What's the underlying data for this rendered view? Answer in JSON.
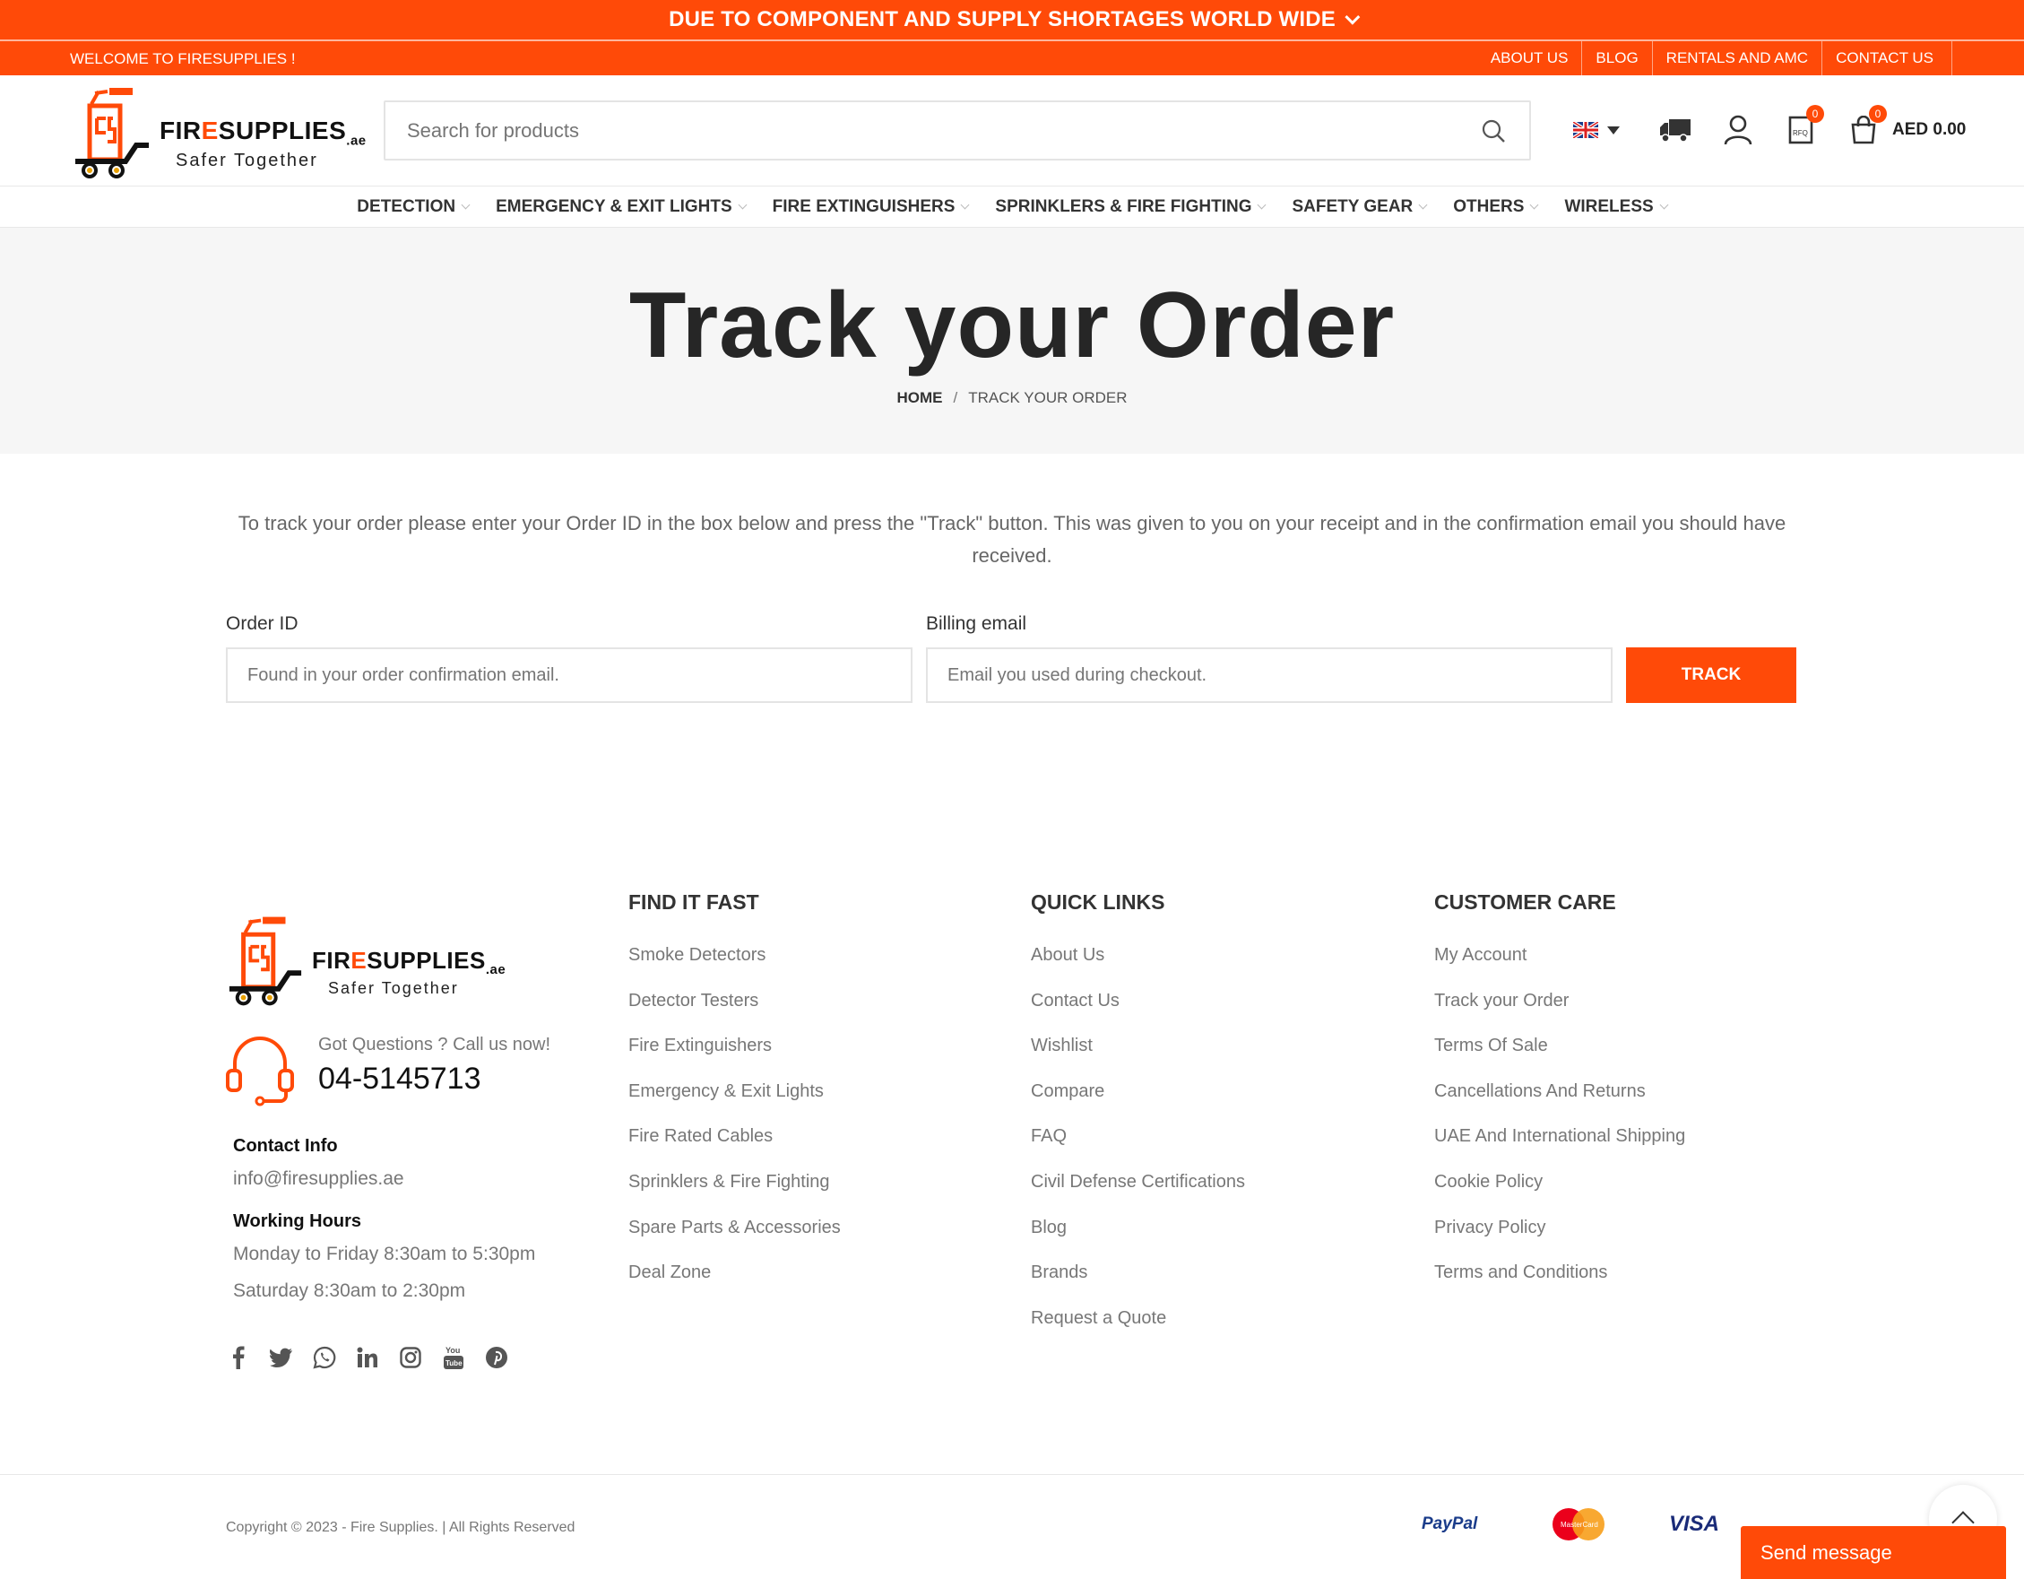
{
  "promo": {
    "text": "DUE TO COMPONENT AND SUPPLY SHORTAGES WORLD WIDE"
  },
  "topbar": {
    "welcome": "WELCOME TO FIRESUPPLIES !",
    "links": [
      "ABOUT US",
      "BLOG",
      "RENTALS AND AMC",
      "CONTACT US"
    ]
  },
  "header": {
    "logo": {
      "brand_prefix": "FIR",
      "brand_e": "E",
      "brand_suffix": "SUPPLIES",
      "brand_tld": ".ae",
      "tagline": "Safer Together"
    },
    "search": {
      "placeholder": "Search for products"
    },
    "cart_total": "AED 0.00",
    "badges": {
      "rfq": "0",
      "cart": "0"
    },
    "icons": [
      "flag-uk-icon",
      "truck-icon",
      "user-icon",
      "rfq-icon",
      "cart-icon",
      "search-icon"
    ]
  },
  "nav": {
    "items": [
      "DETECTION",
      "EMERGENCY & EXIT LIGHTS",
      "FIRE EXTINGUISHERS",
      "SPRINKLERS & FIRE FIGHTING",
      "SAFETY GEAR",
      "OTHERS",
      "WIRELESS"
    ]
  },
  "title": {
    "heading": "Track your Order",
    "breadcrumb_home": "HOME",
    "breadcrumb_sep": "/",
    "breadcrumb_current": "TRACK YOUR ORDER"
  },
  "form": {
    "intro": "To track your order please enter your Order ID in the box below and press the \"Track\" button. This was given to you on your receipt and in the confirmation email you should have received.",
    "order_label": "Order ID",
    "order_placeholder": "Found in your order confirmation email.",
    "email_label": "Billing email",
    "email_placeholder": "Email you used during checkout.",
    "button": "TRACK"
  },
  "footer": {
    "got_questions": "Got Questions ? Call us now!",
    "phone": "04-5145713",
    "contact_label": "Contact Info",
    "contact_email": "info@firesupplies.ae",
    "hours_label": "Working Hours",
    "hours_weekday": "Monday to Friday 8:30am to 5:30pm",
    "hours_saturday": "Saturday 8:30am to 2:30pm",
    "socials": [
      "facebook-icon",
      "twitter-icon",
      "whatsapp-icon",
      "linkedin-icon",
      "instagram-icon",
      "youtube-icon",
      "pinterest-icon"
    ],
    "columns": [
      {
        "title": "FIND IT FAST",
        "links": [
          "Smoke Detectors",
          "Detector Testers",
          "Fire Extinguishers",
          "Emergency & Exit Lights",
          "Fire Rated Cables",
          "Sprinklers & Fire Fighting",
          "Spare Parts & Accessories",
          "Deal Zone"
        ]
      },
      {
        "title": "QUICK LINKS",
        "links": [
          "About Us",
          "Contact Us",
          "Wishlist",
          "Compare",
          "FAQ",
          "Civil Defense Certifications",
          "Blog",
          "Brands",
          "Request a Quote"
        ]
      },
      {
        "title": "CUSTOMER CARE",
        "links": [
          "My Account",
          "Track your Order",
          "Terms Of Sale",
          "Cancellations And Returns",
          "UAE And International Shipping",
          "Cookie Policy",
          "Privacy Policy",
          "Terms and Conditions"
        ]
      }
    ],
    "copyright": "Copyright © 2023 - Fire Supplies. | All Rights Reserved",
    "payments": {
      "paypal": "PayPal",
      "mastercard": "MasterCard",
      "visa": "VISA"
    },
    "send_message": "Send message"
  },
  "colors": {
    "accent": "#ff4a08",
    "text": "#333333",
    "muted": "#777777"
  }
}
